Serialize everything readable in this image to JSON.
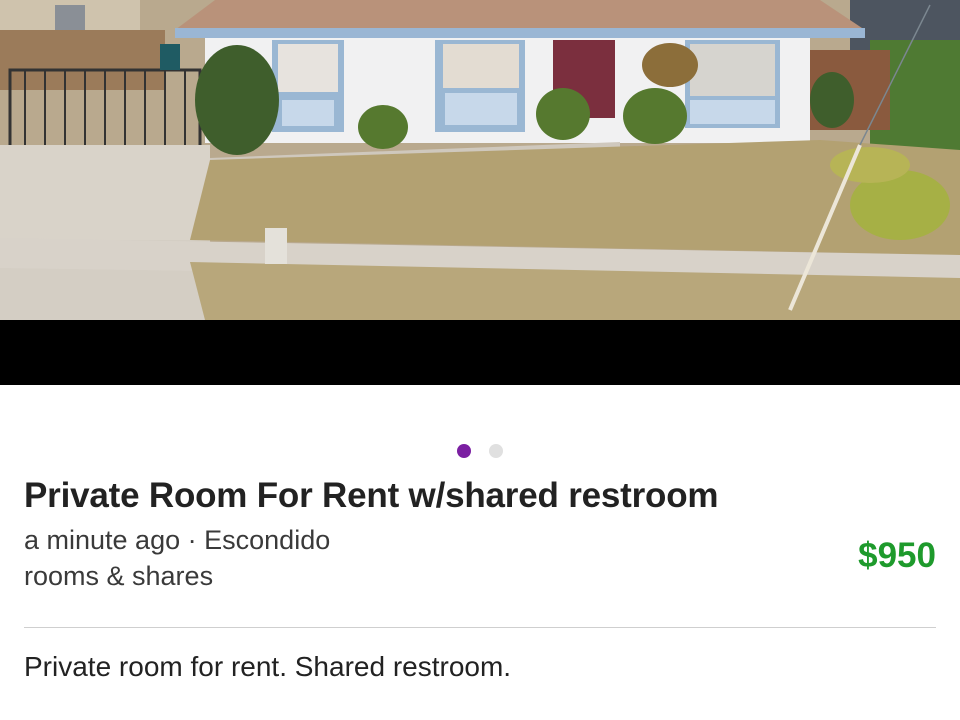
{
  "listing": {
    "title": "Private Room For Rent w/shared restroom",
    "posted": "a minute ago",
    "separator": "·",
    "location": "Escondido",
    "category": "rooms & shares",
    "price": "$950",
    "description": "Private room for rent. Shared restroom."
  },
  "gallery": {
    "image_count": 2,
    "active_index": 0,
    "colors": {
      "active_dot": "#7b1fa2",
      "inactive_dot": "#e0e0e0"
    }
  },
  "colors": {
    "price": "#1e9a2c",
    "title": "#222222"
  }
}
